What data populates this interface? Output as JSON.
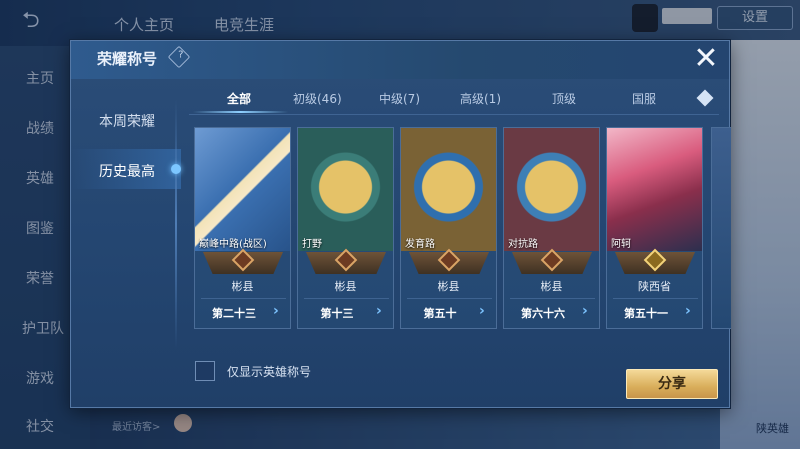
{
  "background": {
    "back_icon": "back-arrow-icon",
    "tabs": [
      "个人主页",
      "电竞生涯"
    ],
    "settings_label": "设置",
    "side_items": [
      "主页",
      "战绩",
      "英雄",
      "图鉴",
      "荣誉",
      "护卫队",
      "游戏",
      "社交"
    ],
    "recent_visitors": "最近访客>",
    "right_hero_label": "陕英雄"
  },
  "modal": {
    "title": "荣耀称号",
    "help_icon": "help-icon",
    "close_icon": "close-icon",
    "left_nav": [
      "本周荣耀",
      "历史最高"
    ],
    "tabs": [
      "全部",
      "初级(46)",
      "中级(7)",
      "高级(1)",
      "顶级",
      "国服"
    ],
    "active_tab": "全部",
    "cards": [
      {
        "name": "巅峰中路(战区)",
        "region": "彬县",
        "rank": "第二十三",
        "theme": "#4a7ab2"
      },
      {
        "name": "打野",
        "region": "彬县",
        "rank": "第十三",
        "theme": "#2b6b5a"
      },
      {
        "name": "发育路",
        "region": "彬县",
        "rank": "第五十",
        "theme": "#7a6030"
      },
      {
        "name": "对抗路",
        "region": "彬县",
        "rank": "第六十六",
        "theme": "#6a3a44"
      },
      {
        "name": "阿轲",
        "region": "陕西省",
        "rank": "第五十一",
        "theme": "#c55a7a"
      }
    ],
    "checkbox_label": "仅显示英雄称号",
    "share_label": "分享"
  }
}
